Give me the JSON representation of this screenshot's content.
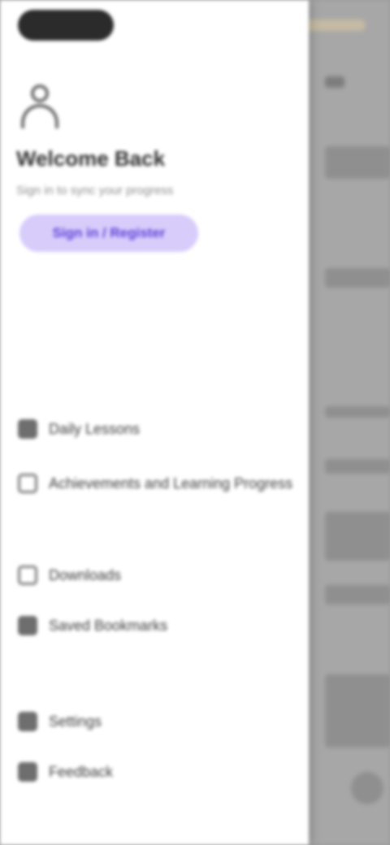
{
  "drawer": {
    "user_name": "Welcome Back",
    "user_subtitle": "Sign in to sync your progress",
    "signin_button": "Sign in / Register",
    "menu": [
      {
        "label": "Daily Lessons",
        "icon": "calendar-icon"
      },
      {
        "label": "Achievements and Learning Progress",
        "icon": "trophy-icon"
      },
      {
        "label": "Downloads",
        "icon": "download-icon"
      },
      {
        "label": "Saved Bookmarks",
        "icon": "bookmark-icon"
      },
      {
        "label": "Settings",
        "icon": "gear-icon"
      },
      {
        "label": "Feedback",
        "icon": "chat-icon"
      }
    ]
  },
  "colors": {
    "accent": "#5a3fd6",
    "accent_bg": "#d8ccfb",
    "scrim": "#a7a7a7"
  }
}
